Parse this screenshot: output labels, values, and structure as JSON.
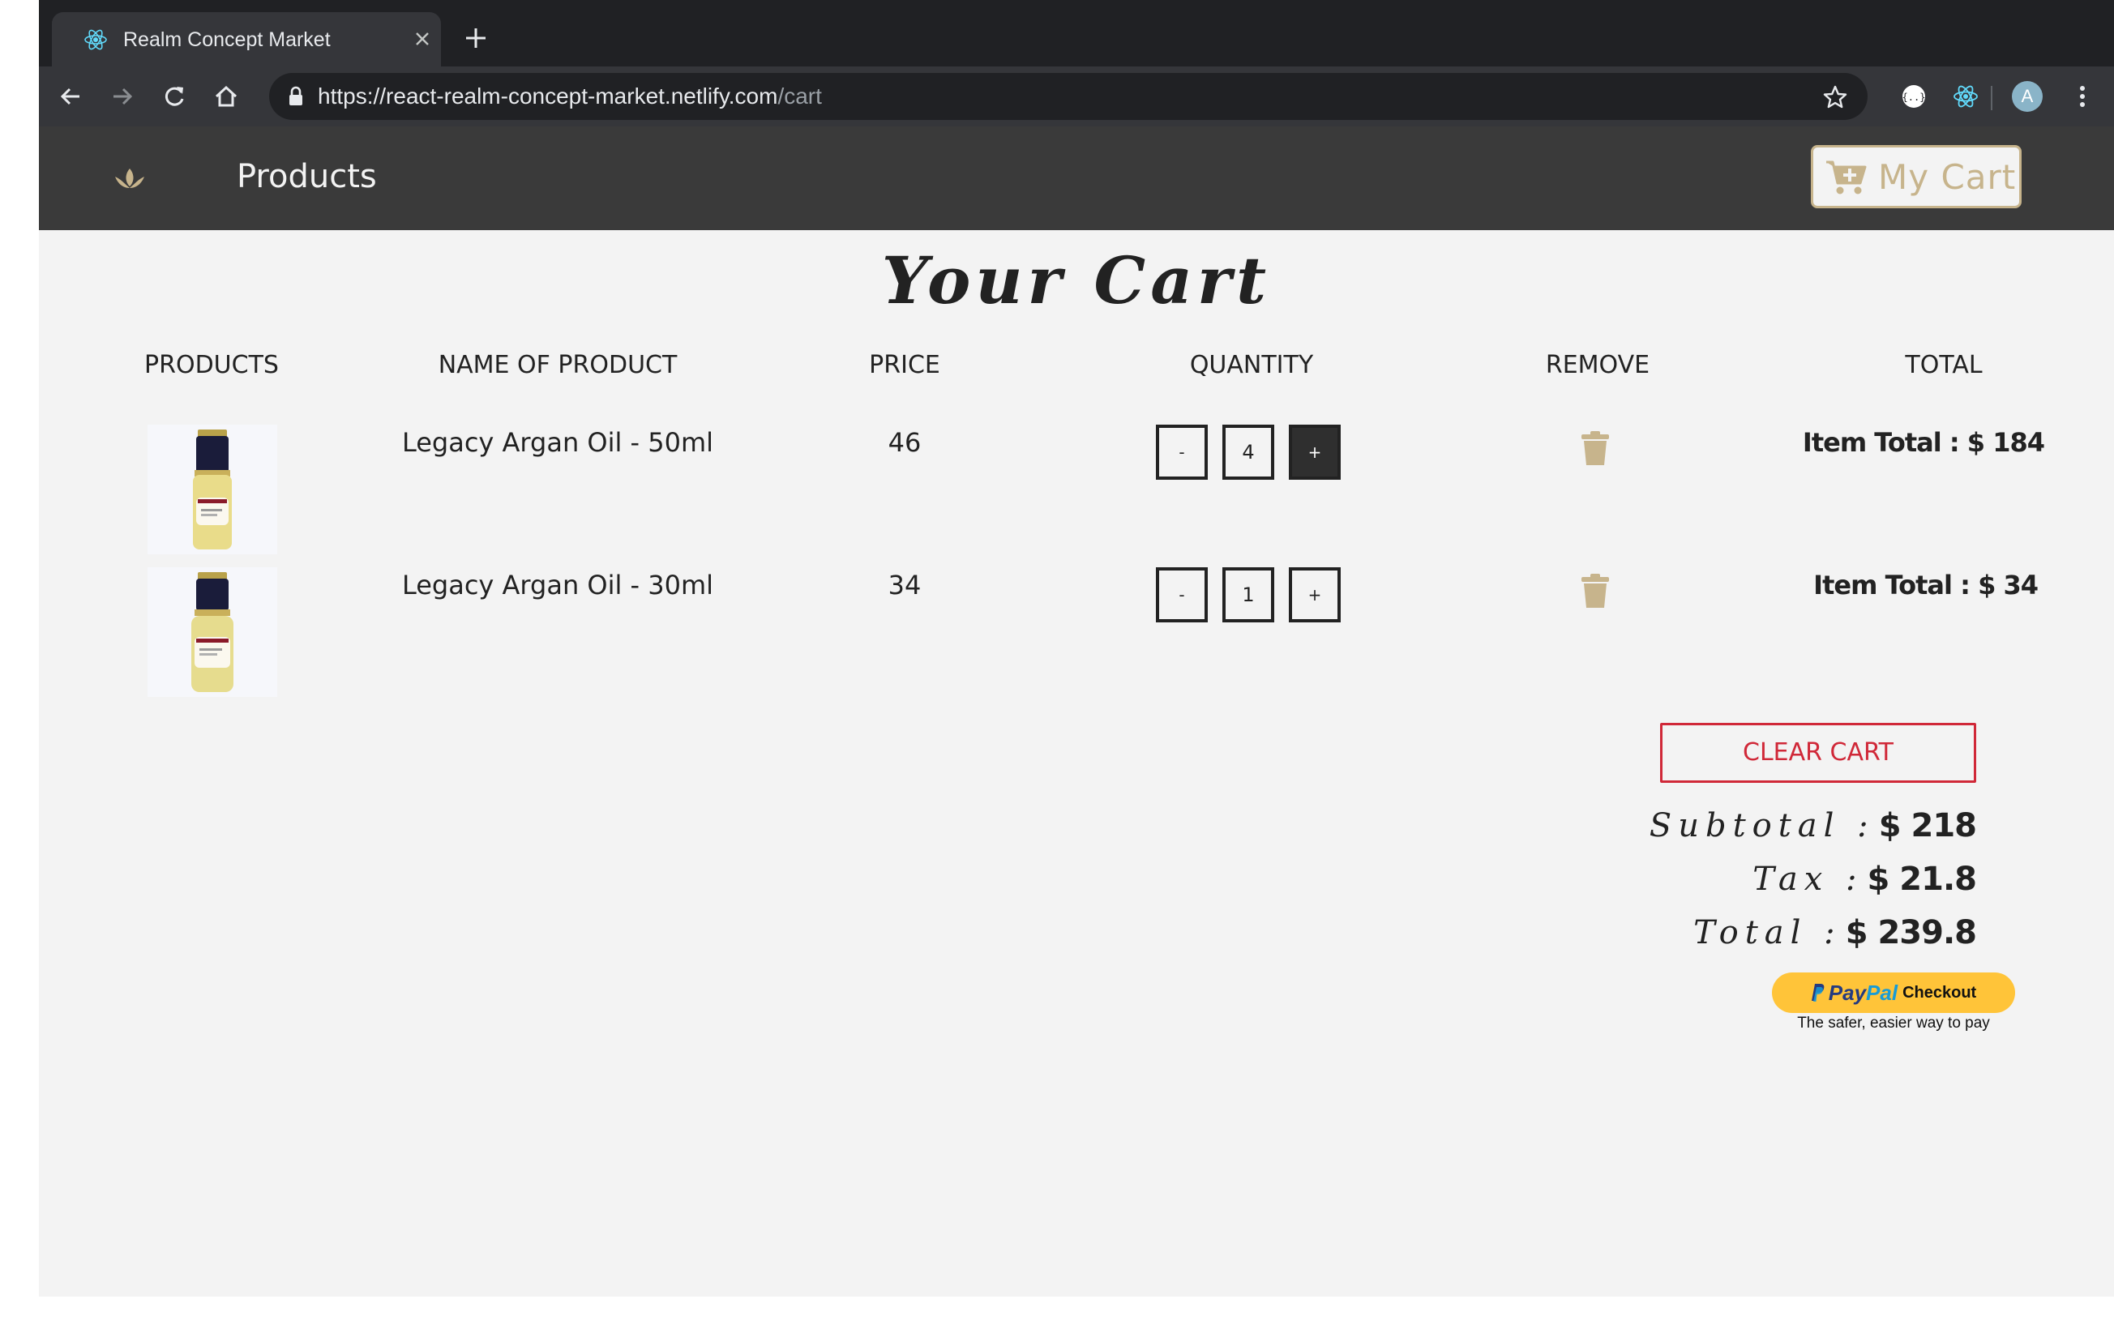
{
  "browser": {
    "tab_title": "Realm Concept Market",
    "url_main": "https://react-realm-concept-market.netlify.com",
    "url_path": "/cart",
    "profile_initial": "A"
  },
  "navbar": {
    "products_link": "Products",
    "cart_label": "My Cart"
  },
  "page_title": "Your Cart",
  "columns": [
    "PRODUCTS",
    "NAME OF PRODUCT",
    "PRICE",
    "QUANTITY",
    "REMOVE",
    "TOTAL"
  ],
  "items": [
    {
      "name": "Legacy Argan Oil - 50ml",
      "price": "46",
      "quantity": "4",
      "item_total": "Item Total : $ 184"
    },
    {
      "name": "Legacy Argan Oil - 30ml",
      "price": "34",
      "quantity": "1",
      "item_total": "Item Total : $ 34"
    }
  ],
  "quantity_controls": {
    "decrement": "-",
    "increment": "+"
  },
  "summary": {
    "clear_cart": "CLEAR CART",
    "subtotal_label": "Subtotal :",
    "subtotal_value": "$ 218",
    "tax_label": "Tax :",
    "tax_value": "$ 21.8",
    "total_label": "Total :",
    "total_value": "$ 239.8"
  },
  "paypal": {
    "brand_pay": "Pay",
    "brand_pal": "Pal",
    "action": "Checkout",
    "tagline": "The safer, easier way to pay"
  },
  "colors": {
    "navbar_bg": "#3a3a3a",
    "accent_gold": "#c7b48c",
    "clear_cart_red": "#d02838",
    "page_bg": "#f3f3f3",
    "paypal_yellow": "#ffc439"
  }
}
